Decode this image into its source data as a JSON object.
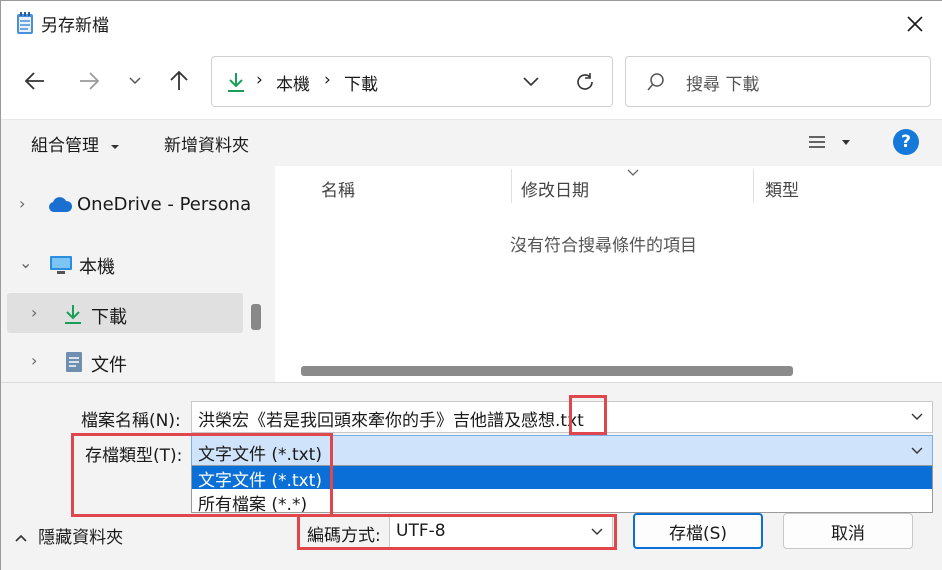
{
  "window": {
    "title": "另存新檔"
  },
  "nav": {
    "back": "←",
    "forward": "→",
    "recent": "⌄",
    "up": "↑",
    "breadcrumb": [
      "本機",
      "下載"
    ],
    "sep": "›",
    "search_placeholder": "搜尋 下載"
  },
  "toolbar": {
    "organize": "組合管理",
    "new_folder": "新增資料夾",
    "help": "?"
  },
  "sidebar": {
    "items": [
      {
        "label": "OneDrive - Persona",
        "arrow": "›"
      },
      {
        "label": "本機",
        "arrow": "⌄"
      },
      {
        "label": "下載",
        "arrow": "›"
      },
      {
        "label": "文件",
        "arrow": "›"
      }
    ]
  },
  "filelist": {
    "columns": [
      "名稱",
      "修改日期",
      "類型"
    ],
    "empty_message": "沒有符合搜尋條件的項目"
  },
  "form": {
    "filename_label": "檔案名稱(N):",
    "filename_value": "洪榮宏《若是我回頭來牽你的手》吉他譜及感想",
    "filename_ext": ".txt",
    "filetype_label": "存檔類型(T):",
    "filetype_value": "文字文件 (*.txt)",
    "filetype_options": [
      "文字文件 (*.txt)",
      "所有檔案  (*.*)"
    ],
    "encoding_label": "編碼方式:",
    "encoding_value": "UTF-8",
    "hide_folders": "隱藏資料夾",
    "save": "存檔(S)",
    "cancel": "取消"
  },
  "colors": {
    "accent": "#0a6fd6",
    "highlight": "#e0474c",
    "download_green": "#18a058"
  }
}
